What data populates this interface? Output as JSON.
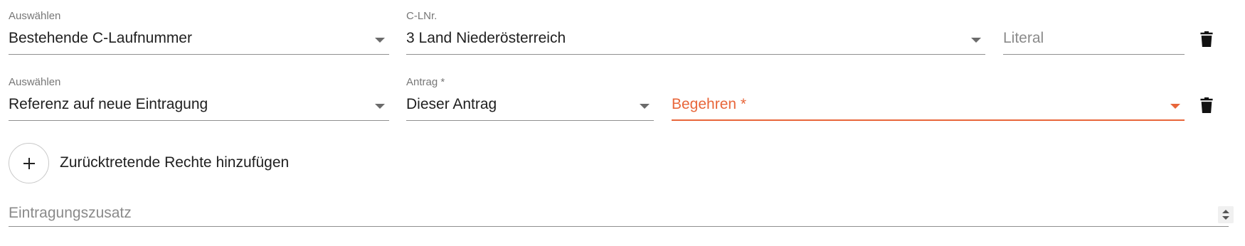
{
  "row1": {
    "select": {
      "label": "Auswählen",
      "value": "Bestehende C-Laufnummer"
    },
    "clnr": {
      "label": "C-LNr.",
      "value": "3 Land Niederösterreich"
    },
    "literal": {
      "placeholder": "Literal"
    }
  },
  "row2": {
    "select": {
      "label": "Auswählen",
      "value": "Referenz auf neue Eintragung"
    },
    "antrag": {
      "label": "Antrag *",
      "value": "Dieser Antrag"
    },
    "begehren": {
      "placeholder": "Begehren *"
    }
  },
  "add_rights": {
    "label": "Zurücktretende Rechte hinzufügen",
    "icon": "plus-icon"
  },
  "eintragungszusatz": {
    "placeholder": "Eintragungszusatz"
  },
  "icons": {
    "delete": "trash-icon",
    "dropdown": "chevron-down-icon",
    "spinner": "stepper-icon"
  },
  "colors": {
    "error": "#e8663a",
    "underline": "#8f8f8f",
    "label": "#777777"
  }
}
